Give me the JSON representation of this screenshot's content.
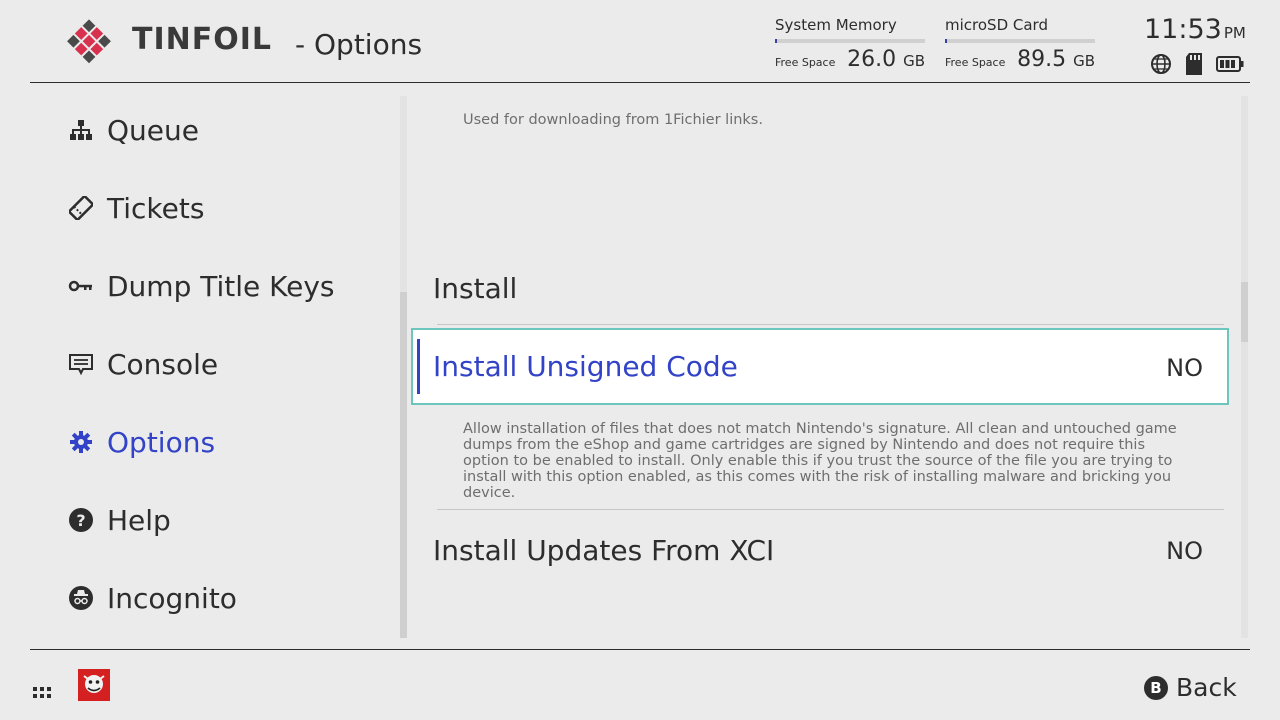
{
  "header": {
    "app_name": "TINFOIL",
    "page_title": "- Options",
    "storage": [
      {
        "label": "System Memory",
        "free_label": "Free Space",
        "value": "26.0",
        "unit": "GB",
        "used_fraction": 0.01
      },
      {
        "label": "microSD Card",
        "free_label": "Free Space",
        "value": "89.5",
        "unit": "GB",
        "used_fraction": 0.01
      }
    ],
    "clock": {
      "time": "11:53",
      "ampm": "PM"
    },
    "status_icons": [
      "globe-icon",
      "sd-card-icon",
      "battery-icon"
    ]
  },
  "sidebar": {
    "items": [
      {
        "label": "Queue",
        "icon": "sitemap-icon",
        "active": false
      },
      {
        "label": "Tickets",
        "icon": "ticket-icon",
        "active": false
      },
      {
        "label": "Dump Title Keys",
        "icon": "key-icon",
        "active": false
      },
      {
        "label": "Console",
        "icon": "console-icon",
        "active": false
      },
      {
        "label": "Options",
        "icon": "gear-icon",
        "active": true
      },
      {
        "label": "Help",
        "icon": "help-icon",
        "active": false
      },
      {
        "label": "Incognito",
        "icon": "incognito-icon",
        "active": false
      }
    ]
  },
  "main": {
    "top_description": "Used for downloading from 1Fichier links.",
    "section_title": "Install",
    "options": [
      {
        "name": "Install Unsigned Code",
        "value": "NO",
        "selected": true,
        "description": "Allow installation of files that does not match Nintendo's signature.  All clean and untouched game dumps from the eShop and game cartridges are signed by Nintendo and does not require this option to be enabled to install.  Only enable this if you trust the source of the file you are trying to install with this option enabled, as this comes with the risk of installing malware and bricking you device."
      },
      {
        "name": "Install Updates From XCI",
        "value": "NO",
        "selected": false
      }
    ]
  },
  "footer": {
    "back_button": "B",
    "back_label": "Back"
  },
  "colors": {
    "accent": "#3243c8",
    "selection_border": "#6cc6be",
    "background": "#ebebeb",
    "logo_red": "#d8304f",
    "logo_dark": "#4a4a4a"
  }
}
